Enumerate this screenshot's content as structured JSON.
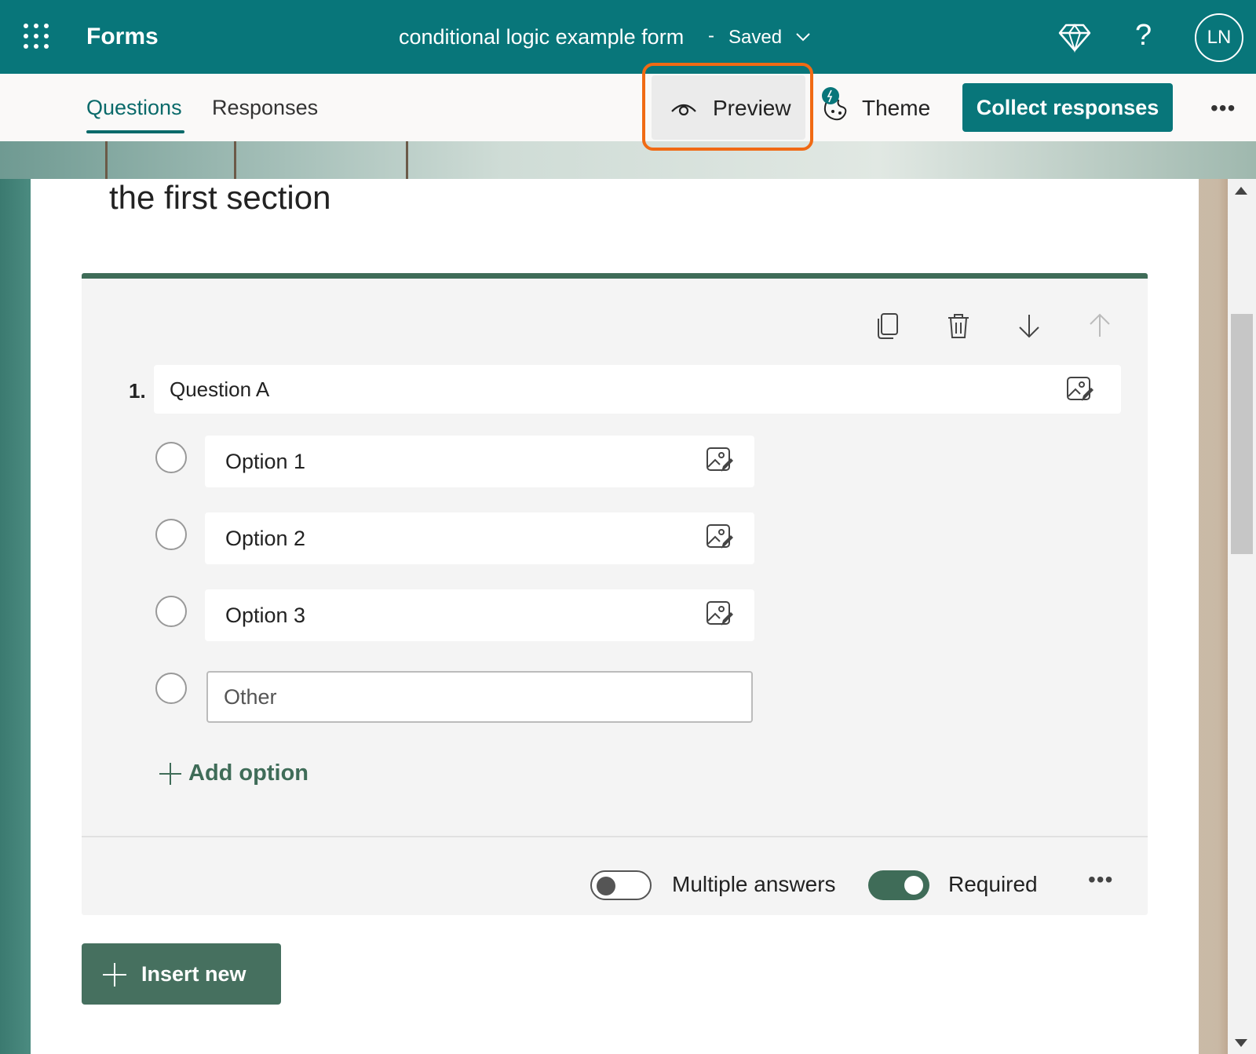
{
  "header": {
    "app_name": "Forms",
    "form_title": "conditional logic example form",
    "separator": "-",
    "save_status": "Saved",
    "avatar_initials": "LN",
    "help_symbol": "?",
    "icons": [
      "waffle-icon",
      "chevron-down-icon",
      "diamond-icon",
      "help-icon"
    ]
  },
  "subbar": {
    "tabs": [
      {
        "label": "Questions",
        "active": true
      },
      {
        "label": "Responses",
        "active": false
      }
    ],
    "preview_label": "Preview",
    "theme_label": "Theme",
    "collect_label": "Collect responses",
    "more_symbol": "•••"
  },
  "section": {
    "title": "the first section"
  },
  "question": {
    "number": "1.",
    "title": "Question A",
    "options": [
      {
        "label": "Option 1"
      },
      {
        "label": "Option 2"
      },
      {
        "label": "Option 3"
      }
    ],
    "other_placeholder": "Other",
    "add_option_label": "Add option",
    "multiple_answers_label": "Multiple answers",
    "multiple_answers_on": false,
    "required_label": "Required",
    "required_on": true,
    "more_symbol": "•••"
  },
  "insert_new_label": "Insert new",
  "colors": {
    "brand_teal": "#08767a",
    "accent_green": "#3f6c58",
    "highlight_orange": "#f06a14"
  }
}
